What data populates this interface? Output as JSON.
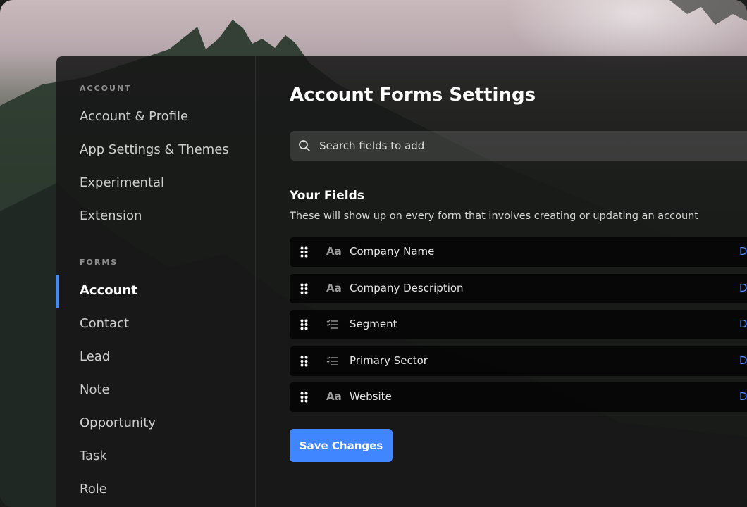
{
  "sidebar": {
    "account_section": "ACCOUNT",
    "account_items": [
      {
        "label": "Account & Profile"
      },
      {
        "label": "App Settings & Themes"
      },
      {
        "label": "Experimental"
      },
      {
        "label": "Extension"
      }
    ],
    "forms_section": "FORMS",
    "forms_items": [
      {
        "label": "Account",
        "active": true
      },
      {
        "label": "Contact"
      },
      {
        "label": "Lead"
      },
      {
        "label": "Note"
      },
      {
        "label": "Opportunity"
      },
      {
        "label": "Task"
      },
      {
        "label": "Role"
      }
    ]
  },
  "main": {
    "title": "Account Forms Settings",
    "search": {
      "placeholder": "Search fields to add",
      "icon": "search-icon"
    },
    "your_fields_title": "Your Fields",
    "your_fields_description": "These will show up on every form that involves creating or updating an account",
    "fields": [
      {
        "type_icon": "text-type-icon",
        "type_glyph": "Aa",
        "label": "Company Name",
        "action": "D"
      },
      {
        "type_icon": "text-type-icon",
        "type_glyph": "Aa",
        "label": "Company Description",
        "action": "D"
      },
      {
        "type_icon": "list-type-icon",
        "type_glyph": "",
        "label": "Segment",
        "action": "D"
      },
      {
        "type_icon": "list-type-icon",
        "type_glyph": "",
        "label": "Primary Sector",
        "action": "D"
      },
      {
        "type_icon": "text-type-icon",
        "type_glyph": "Aa",
        "label": "Website",
        "action": "D"
      }
    ],
    "save_label": "Save Changes"
  },
  "colors": {
    "accent": "#3f86ff",
    "link": "#4f8fff"
  }
}
